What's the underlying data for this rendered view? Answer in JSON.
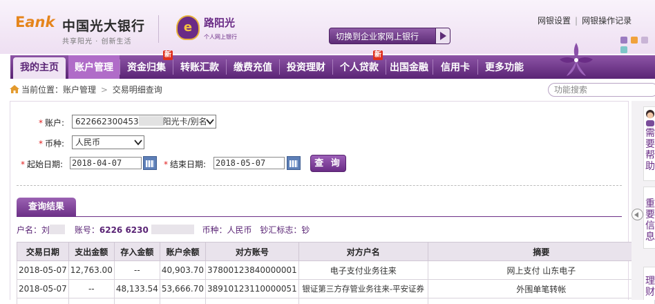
{
  "header": {
    "ebank_e": "E",
    "ebank_rest": "ank",
    "bank_name": "中国光大银行",
    "slogan": "共享阳光 · 创新生活",
    "sunshine_logo_char": "e",
    "sunshine_name": "路阳光",
    "sunshine_sub": "个人网上银行",
    "switch_label": "切换到企业家网上银行",
    "links": [
      "网银设置",
      "网银操作记录"
    ],
    "theme_colors": [
      "#9b7bc1",
      "#f0a23c",
      "#c9b4d6",
      "#7ec6c9"
    ]
  },
  "nav": {
    "items": [
      {
        "label": "我的主页"
      },
      {
        "label": "账户管理"
      },
      {
        "label": "资金归集"
      },
      {
        "label": "转账汇款"
      },
      {
        "label": "缴费充值"
      },
      {
        "label": "投资理财"
      },
      {
        "label": "个人贷款"
      },
      {
        "label": "出国金融"
      },
      {
        "label": "信用卡"
      },
      {
        "label": "更多功能"
      }
    ],
    "new_tag": "新"
  },
  "breadcrumb": {
    "prefix": "当前位置：",
    "level1": "账户管理",
    "sep": ">",
    "level2": "交易明细查询"
  },
  "search": {
    "placeholder": "功能搜索"
  },
  "form": {
    "required_mark": "*",
    "account_label": "账户:",
    "account_value_prefix": "622662300453",
    "account_value_suffix": "阳光卡/别名",
    "currency_label": "币种:",
    "currency_value": "人民币",
    "start_label": "起始日期:",
    "start_value": "2018-04-07",
    "end_label": "结束日期:",
    "end_value": "2018-05-07",
    "query_label": "查 询"
  },
  "result": {
    "tab_label": "查询结果",
    "name_label": "户名：",
    "name_value": "刘",
    "acct_label": "账号：",
    "acct_value": "6226 6230",
    "currency_label": "币种：",
    "currency_value": "人民币",
    "flag_label": "钞汇标志：",
    "flag_value": "钞"
  },
  "table": {
    "headers": [
      "交易日期",
      "支出金额",
      "存入金额",
      "账户余额",
      "对方账号",
      "对方户名",
      "摘要"
    ],
    "rows": [
      [
        "2018-05-07",
        "12,763.00",
        "--",
        "40,903.70",
        "37800123840000001",
        "电子支付业务往来",
        "网上支付 山东电子"
      ],
      [
        "2018-05-07",
        "--",
        "48,133.54",
        "53,666.70",
        "38910123110000051",
        "银证第三方存管业务往来-平安证券",
        "外围单笔转帐"
      ]
    ]
  },
  "sidebar": {
    "panel1": "需要帮助",
    "panel2": "重要信息",
    "panel3": "理财"
  }
}
